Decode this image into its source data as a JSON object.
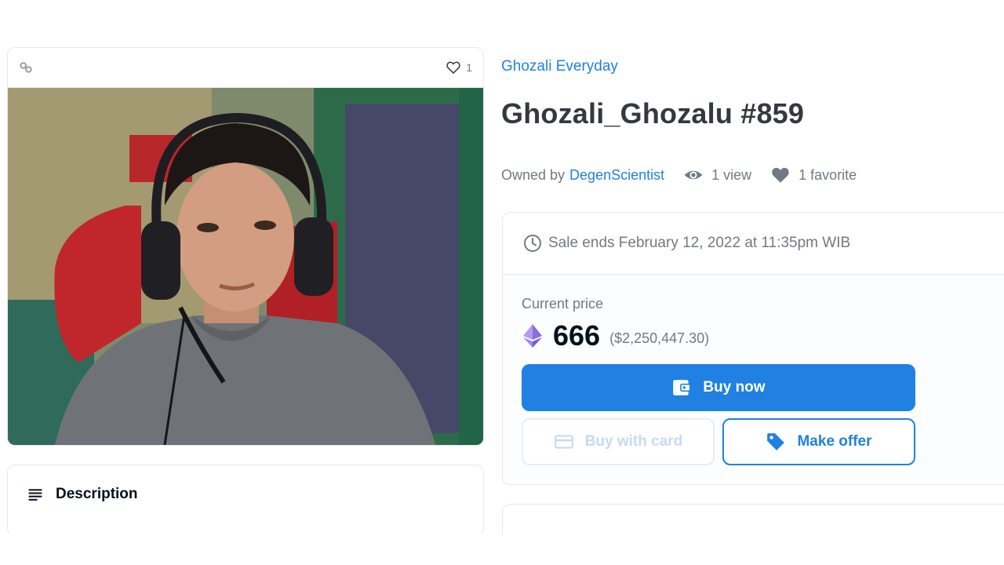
{
  "media": {
    "favorites_count": "1",
    "chain_icon": "link-icon",
    "favorite_icon": "heart-outline-icon"
  },
  "description": {
    "label": "Description",
    "icon": "text-lines-icon"
  },
  "item": {
    "collection": "Ghozali Everyday",
    "title": "Ghozali_Ghozalu #859",
    "owned_by_label": "Owned by",
    "owner": "DegenScientist",
    "views": "1 view",
    "favorites": "1 favorite"
  },
  "sale": {
    "ends_text": "Sale ends February 12, 2022 at 11:35pm WIB",
    "current_price_label": "Current price",
    "price": "666",
    "price_usd": "($2,250,447.30)",
    "currency_icon": "ethereum-icon"
  },
  "buttons": {
    "buy_now": "Buy now",
    "buy_with_card": "Buy with card",
    "make_offer": "Make offer"
  },
  "colors": {
    "accent": "#2081e2",
    "text": "#353840",
    "muted": "#707a83"
  }
}
